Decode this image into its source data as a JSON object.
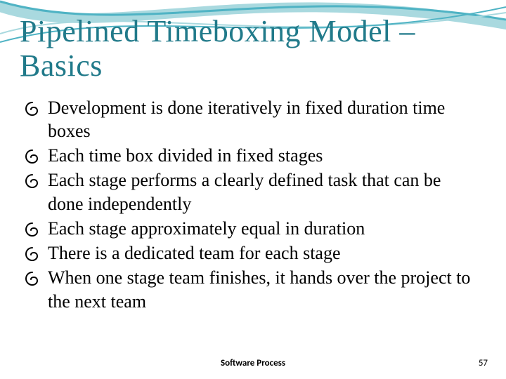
{
  "title": "Pipelined Timeboxing Model – Basics",
  "bullets": [
    "Development is done iteratively in fixed duration time boxes",
    "Each time box divided in fixed stages",
    "Each stage performs a clearly defined task that can be done independently",
    "Each stage approximately equal in duration",
    "There is a dedicated team for each stage",
    "When one stage team finishes, it hands over the project to the next team"
  ],
  "footer": "Software Process",
  "page_number": "57",
  "colors": {
    "title": "#217a8a",
    "wave1": "#4fb3c4",
    "wave2": "#a9d9df"
  }
}
